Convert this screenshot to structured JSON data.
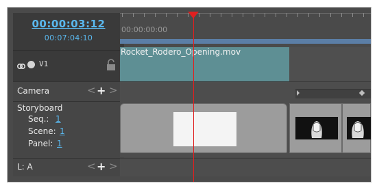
{
  "timecode": {
    "current": "00:00:03:12",
    "total": "00:07:04:10"
  },
  "ruler": {
    "start_time": "00:00:00:00"
  },
  "tracks": {
    "video": {
      "label": "V1",
      "clip_name": "Rocket_Rodero_Opening.mov",
      "icons": [
        "visibility-toggle-icon",
        "record-dot-icon",
        "lock-icon"
      ]
    },
    "camera": {
      "label": "Camera",
      "prev": "<",
      "add": "+",
      "next": ">"
    },
    "storyboard": {
      "label": "Storyboard",
      "seq_label": "Seq.:",
      "seq_value": "1",
      "scene_label": "Scene:",
      "scene_value": "1",
      "panel_label": "Panel:",
      "panel_value": "1"
    },
    "layer": {
      "label": "L: A",
      "prev": "<",
      "add": "+",
      "next": ">"
    }
  },
  "colors": {
    "accent": "#5ab8ee",
    "playhead": "#e02020",
    "clip": "#5e8f94"
  }
}
